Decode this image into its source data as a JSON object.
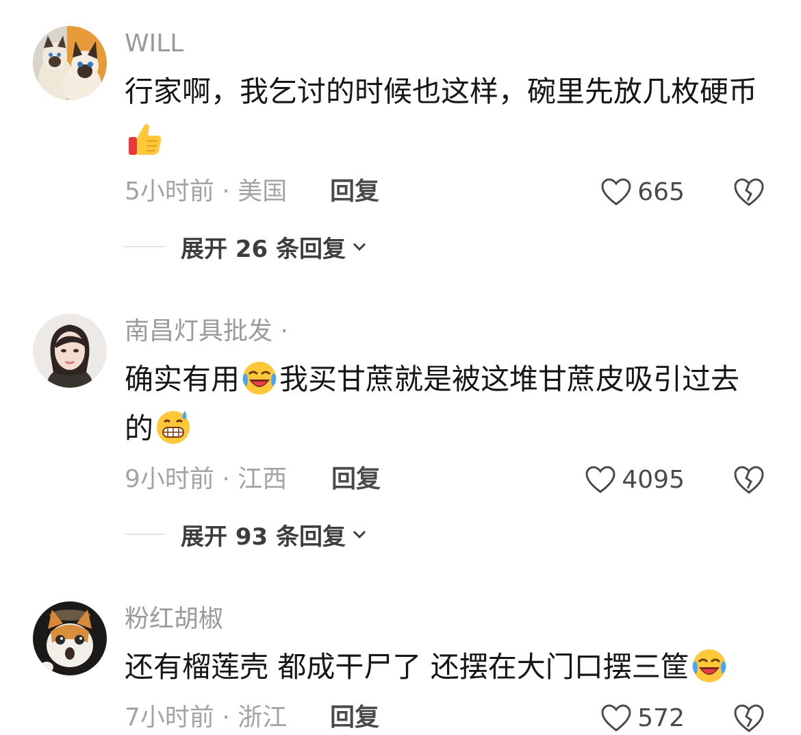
{
  "comments": [
    {
      "username": "WILL",
      "text_before_emoji": "行家啊，我乞讨的时候也这样，碗里先放几枚硬币",
      "text_after_emoji": "",
      "emoji": "thumbs-up",
      "meta": "5小时前 · 美国",
      "reply_label": "回复",
      "likes": "665",
      "expand_label": "展开 26 条回复"
    },
    {
      "username": "南昌灯具批发 ·",
      "text_before_emoji": "确实有用",
      "text_after_emoji": "我买甘蔗就是被这堆甘蔗皮吸引过去的",
      "emoji": "laughing-crying",
      "emoji2": "grinning-sweat",
      "meta": "9小时前 · 江西",
      "reply_label": "回复",
      "likes": "4095",
      "expand_label": "展开 93 条回复"
    },
    {
      "username": "粉红胡椒",
      "text_before_emoji": "还有榴莲壳 都成干尸了 还摆在大门口摆三筐",
      "text_after_emoji": "",
      "emoji": "laughing-crying",
      "meta": "7小时前 · 浙江",
      "reply_label": "回复",
      "likes": "572"
    }
  ],
  "colors": {
    "username": "#9a9a9a",
    "meta": "#a3a3a3",
    "body_text": "#161616"
  }
}
